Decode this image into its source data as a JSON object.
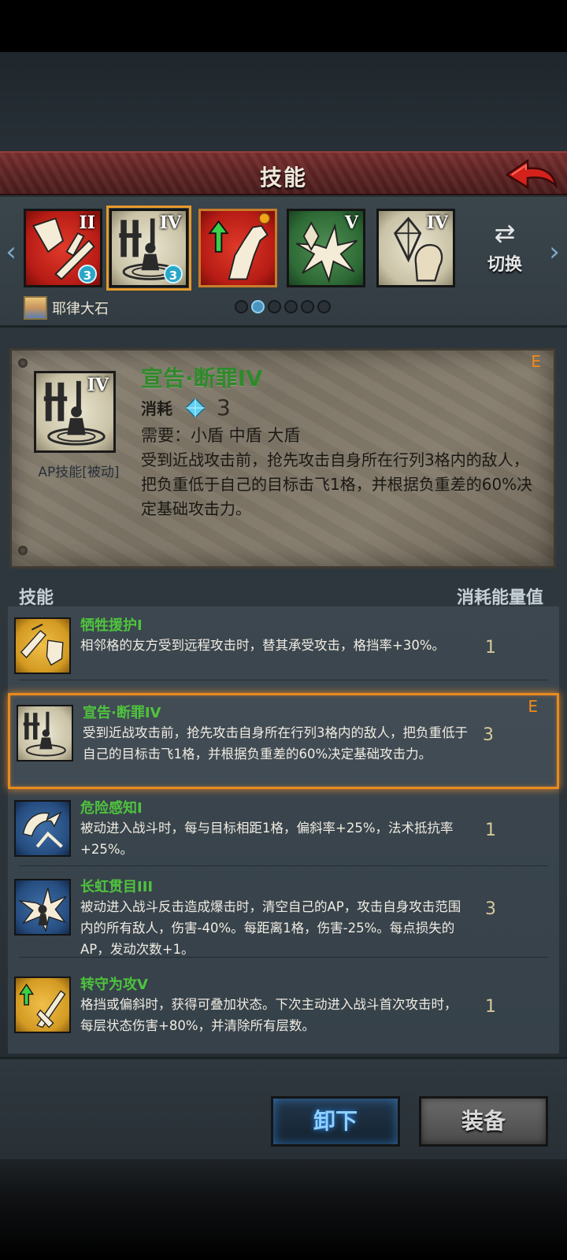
{
  "header": {
    "title": "技能"
  },
  "strip": {
    "slots": [
      {
        "roman": "II",
        "gem": "3"
      },
      {
        "roman": "IV",
        "gem": "3"
      },
      {
        "roman": ""
      },
      {
        "roman": "V"
      },
      {
        "roman": "IV"
      }
    ],
    "switch_label": "切换",
    "hero_name": "耶律大石",
    "page_count": 6,
    "page_active": 2
  },
  "detail": {
    "roman": "IV",
    "type": "AP技能[被动]",
    "name": "宣告·断罪IV",
    "grade": "E",
    "cost_label": "消耗",
    "cost_value": "3",
    "require": "需要：小盾 中盾 大盾",
    "description": "受到近战攻击前，抢先攻击自身所在行列3格内的敌人，把负重低于自己的目标击飞1格，并根据负重差的60%决定基础攻击力。"
  },
  "list": {
    "header_left": "技能",
    "header_right": "消耗能量值",
    "items": [
      {
        "name": "牺牲援护I",
        "desc": "相邻格的友方受到远程攻击时，替其承受攻击，格挡率+30%。",
        "cost": "1"
      },
      {
        "name": "宣告·断罪IV",
        "desc": "受到近战攻击前，抢先攻击自身所在行列3格内的敌人，把负重低于自己的目标击飞1格，并根据负重差的60%决定基础攻击力。",
        "cost": "3",
        "grade": "E"
      },
      {
        "name": "危险感知I",
        "desc": "被动进入战斗时，每与目标相距1格，偏斜率+25%，法术抵抗率+25%。",
        "cost": "1"
      },
      {
        "name": "长虹贯目III",
        "desc": "被动进入战斗反击造成爆击时，清空自己的AP，攻击自身攻击范围内的所有敌人，伤害-40%。每距离1格，伤害-25%。每点损失的AP，发动次数+1。",
        "cost": "3"
      },
      {
        "name": "转守为攻V",
        "desc": "格挡或偏斜时，获得可叠加状态。下次主动进入战斗首次攻击时，每层状态伤害+80%，并清除所有层数。",
        "cost": "1"
      }
    ]
  },
  "buttons": {
    "unequip": "卸下",
    "equip": "装备"
  },
  "colors": {
    "accent_orange": "#e88a1f",
    "skill_green": "#4fc23e",
    "header_red": "#5e2424"
  }
}
